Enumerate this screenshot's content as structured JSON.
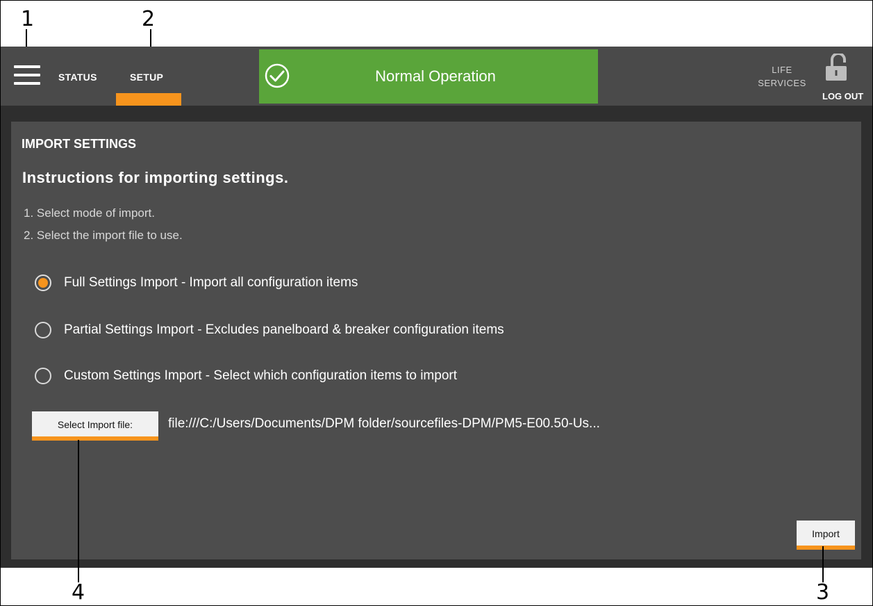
{
  "callouts": [
    "1",
    "2",
    "3",
    "4"
  ],
  "header": {
    "nav_status": "STATUS",
    "nav_setup": "SETUP",
    "status_banner": "Normal Operation",
    "life_services_line1": "LIFE",
    "life_services_line2": "SERVICES",
    "logout": "LOG OUT",
    "icons": [
      "menu-icon",
      "check-circle-icon",
      "lock-icon"
    ]
  },
  "panel": {
    "title": "IMPORT SETTINGS",
    "instructions_heading": "Instructions for importing settings.",
    "steps": [
      "1. Select mode of import.",
      "2. Select the import file to use."
    ],
    "options": [
      {
        "label": "Full Settings Import - Import all configuration items",
        "selected": true
      },
      {
        "label": "Partial Settings Import - Excludes panelboard & breaker configuration items",
        "selected": false
      },
      {
        "label": "Custom Settings Import - Select which configuration items to import",
        "selected": false
      }
    ],
    "select_file_button": "Select Import file:",
    "file_path": "file:///C:/Users/Documents/DPM folder/sourcefiles-DPM/PM5-E00.50-Us...",
    "import_button": "Import"
  },
  "colors": {
    "accent": "#f7941d",
    "status_ok": "#5aa53a",
    "header_bg": "#4a4a4a",
    "panel_bg": "#4d4d4d"
  }
}
